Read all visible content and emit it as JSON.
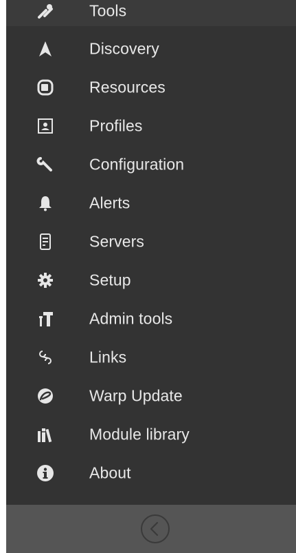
{
  "sidebar": {
    "items": [
      {
        "label": "Tools",
        "icon": "tools-icon"
      },
      {
        "label": "Discovery",
        "icon": "discovery-icon"
      },
      {
        "label": "Resources",
        "icon": "resources-icon"
      },
      {
        "label": "Profiles",
        "icon": "profiles-icon"
      },
      {
        "label": "Configuration",
        "icon": "wrench-icon"
      },
      {
        "label": "Alerts",
        "icon": "bell-icon"
      },
      {
        "label": "Servers",
        "icon": "server-icon"
      },
      {
        "label": "Setup",
        "icon": "gear-icon"
      },
      {
        "label": "Admin tools",
        "icon": "hammer-icon"
      },
      {
        "label": "Links",
        "icon": "links-icon"
      },
      {
        "label": "Warp Update",
        "icon": "warp-update-icon"
      },
      {
        "label": "Module library",
        "icon": "books-icon"
      },
      {
        "label": "About",
        "icon": "info-icon"
      }
    ]
  },
  "footer": {
    "collapse_icon": "chevron-left-circle-icon"
  },
  "colors": {
    "sidebar_bg": "#333333",
    "footer_bg": "#555555",
    "text": "#e8e8e8",
    "icon": "#e6e6e6"
  }
}
